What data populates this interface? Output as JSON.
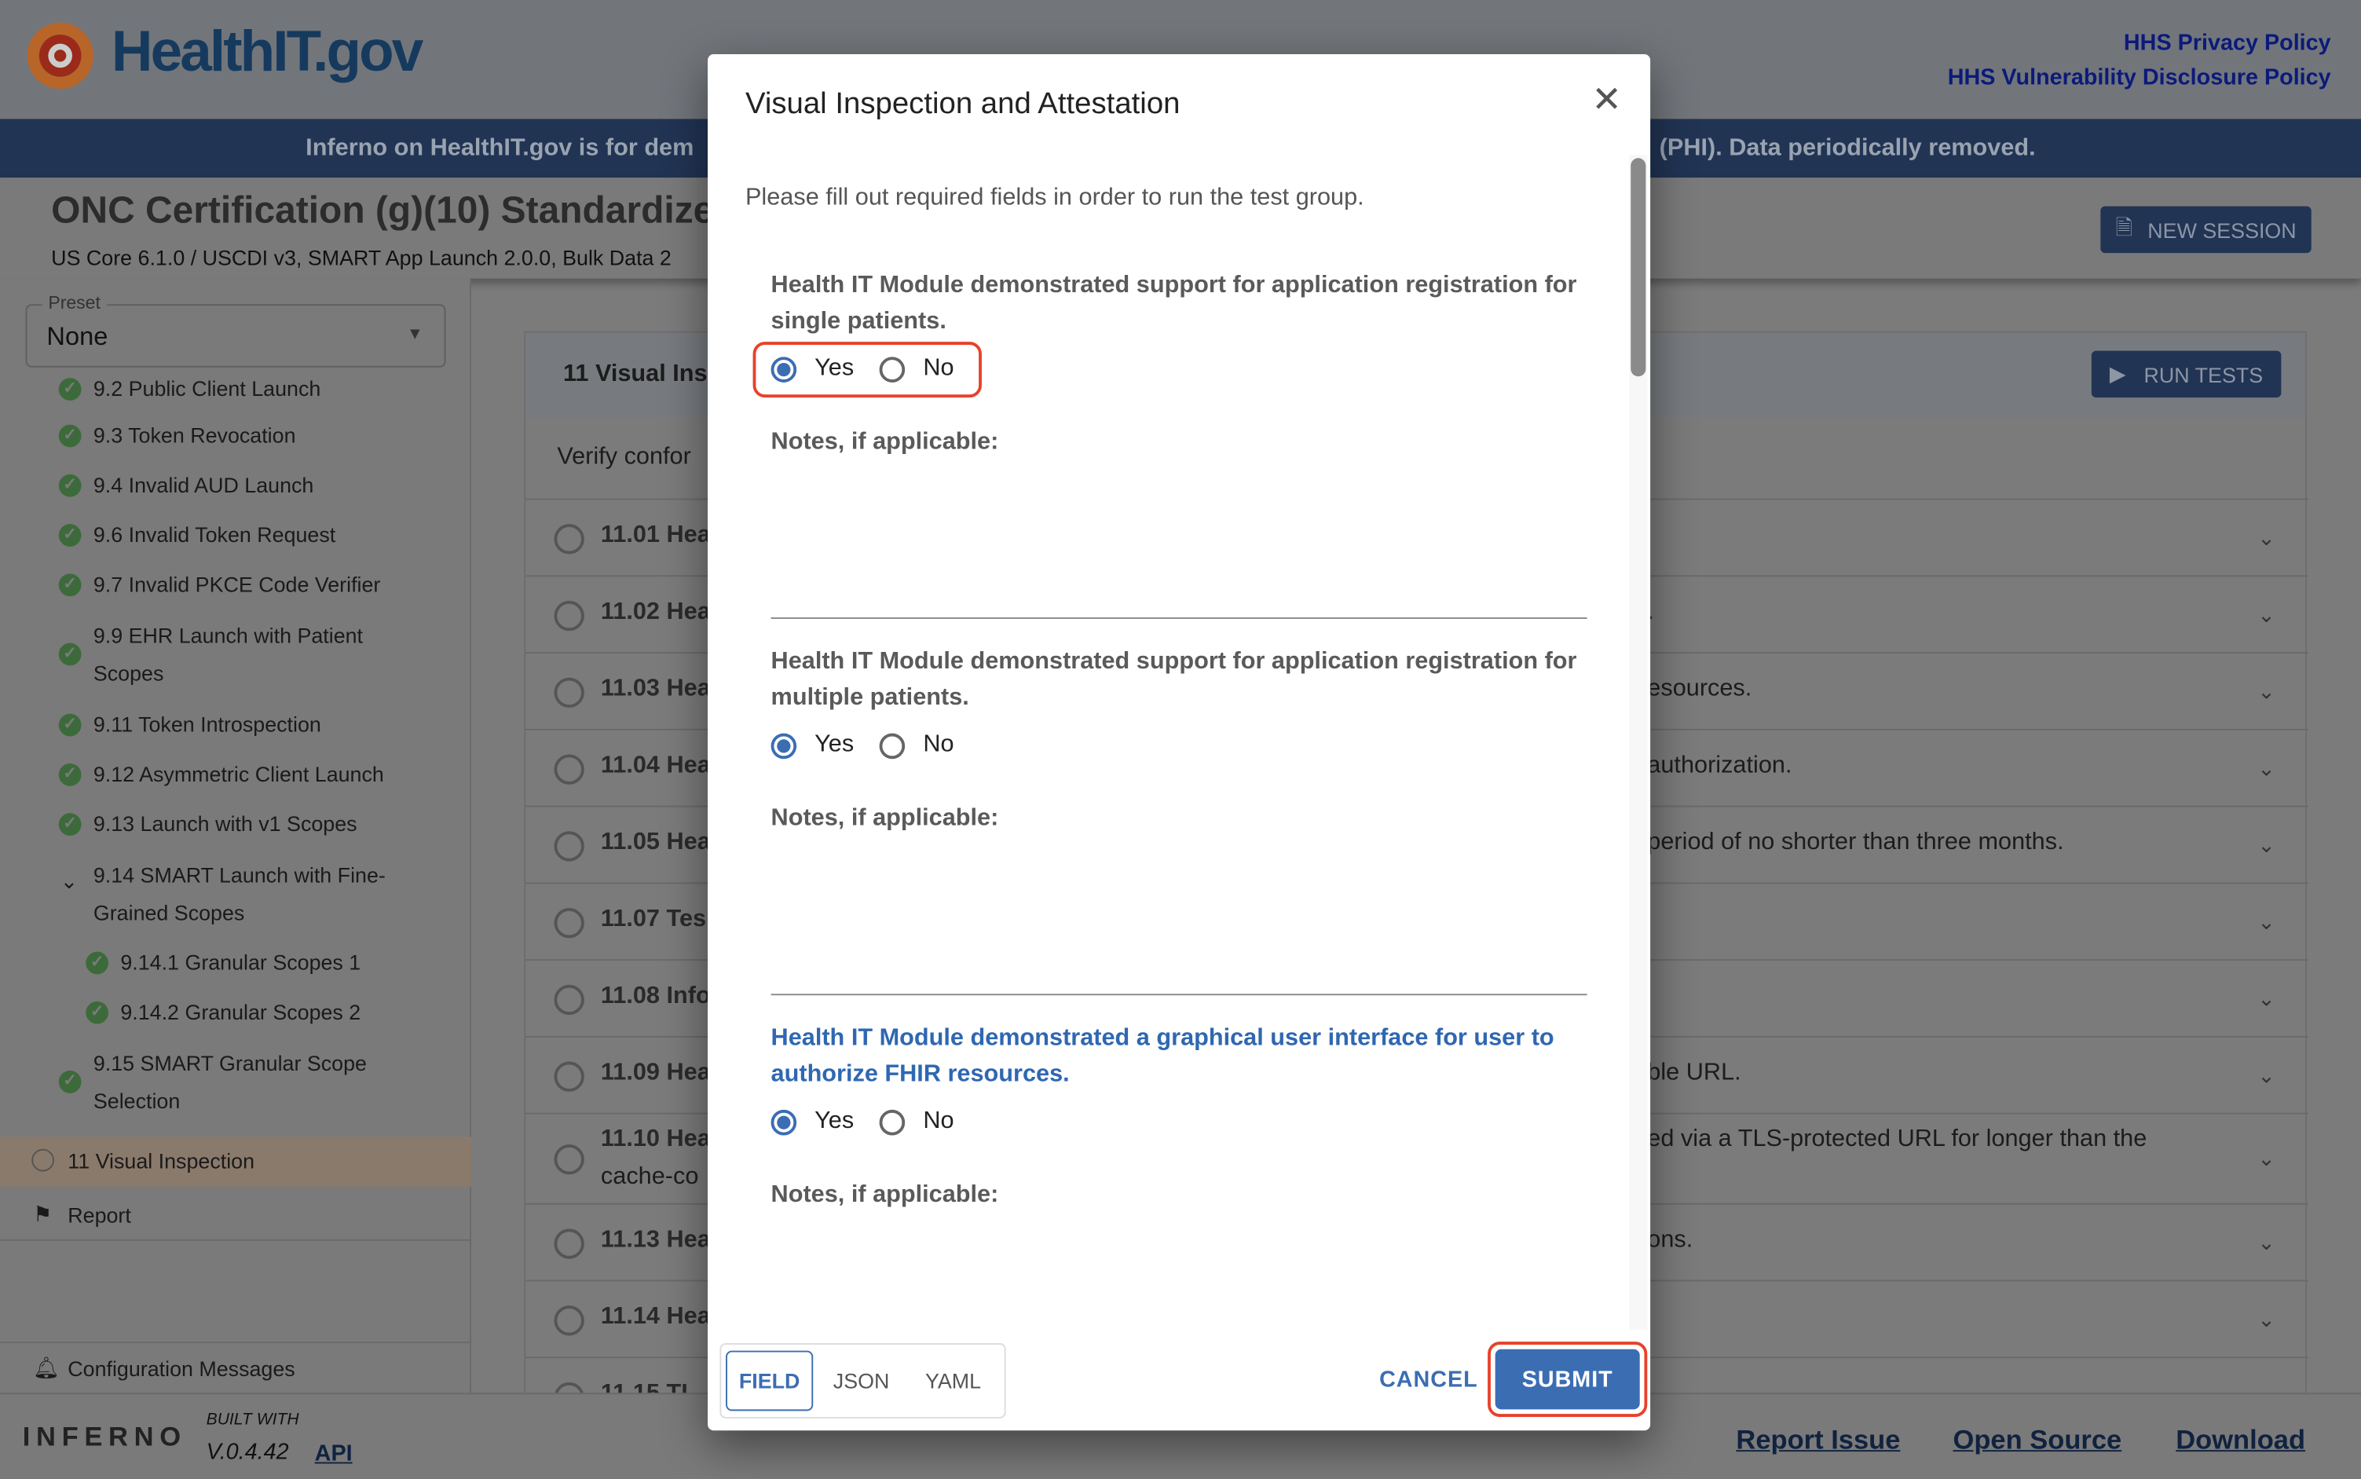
{
  "header": {
    "logo": "HealthIT.gov",
    "links": [
      "HHS Privacy Policy",
      "HHS Vulnerability Disclosure Policy"
    ]
  },
  "banner": {
    "left": "Inferno on HealthIT.gov is for dem",
    "right": "(PHI). Data periodically removed."
  },
  "title": {
    "main": "ONC Certification (g)(10) Standardize",
    "subtitle": "US Core 6.1.0 / USCDI v3, SMART App Launch 2.0.0, Bulk Data 2",
    "new_session": "NEW SESSION"
  },
  "sidebar": {
    "preset_label": "Preset",
    "preset_value": "None",
    "items": [
      {
        "label": "9.2 Public Client Launch",
        "status": "pass"
      },
      {
        "label": "9.3 Token Revocation",
        "status": "pass"
      },
      {
        "label": "9.4 Invalid AUD Launch",
        "status": "pass"
      },
      {
        "label": "9.6 Invalid Token Request",
        "status": "pass"
      },
      {
        "label": "9.7 Invalid PKCE Code Verifier",
        "status": "pass"
      },
      {
        "label": "9.9 EHR Launch with Patient Scopes",
        "status": "pass"
      },
      {
        "label": "9.11 Token Introspection",
        "status": "pass"
      },
      {
        "label": "9.12 Asymmetric Client Launch",
        "status": "pass"
      },
      {
        "label": "9.13 Launch with v1 Scopes",
        "status": "pass"
      },
      {
        "label": "9.14 SMART Launch with Fine-Grained Scopes",
        "status": "expanded"
      },
      {
        "label": "9.14.1 Granular Scopes 1",
        "status": "pass"
      },
      {
        "label": "9.14.2 Granular Scopes 2",
        "status": "pass"
      },
      {
        "label": "9.15 SMART Granular Scope Selection",
        "status": "pass"
      },
      {
        "label": "11 Visual Inspection",
        "status": "pending"
      }
    ],
    "report": "Report",
    "config": "Configuration Messages"
  },
  "main": {
    "group_title": "11 Visual Ins",
    "run_tests": "RUN TESTS",
    "description": "Verify confor",
    "rows": [
      {
        "left": "11.01 Hea",
        "right": ""
      },
      {
        "left": "11.02 Hea",
        "right": "."
      },
      {
        "left": "11.03 Hea",
        "right": "esources."
      },
      {
        "left": "11.04 Hea",
        "right": "authorization."
      },
      {
        "left": "11.05 Hea",
        "right": "period of no shorter than three months."
      },
      {
        "left": "11.07 Tes",
        "right": ""
      },
      {
        "left": "11.08 Info",
        "right": ""
      },
      {
        "left": "11.09 Hea",
        "right": "ble URL."
      },
      {
        "left": "11.10 Hea",
        "left2": "cache-co",
        "right": "ed via a TLS-protected URL for longer than the"
      },
      {
        "left": "11.13 Hea",
        "right": "ons."
      },
      {
        "left": "11.14 Hea",
        "right": ""
      },
      {
        "left": "11.15 TL",
        "right": ""
      }
    ]
  },
  "footer": {
    "built_with": "BUILT WITH",
    "version": "V.0.4.42",
    "api": "API",
    "links": [
      "Report Issue",
      "Open Source",
      "Download"
    ],
    "logo": "INFERNO"
  },
  "modal": {
    "title": "Visual Inspection and Attestation",
    "instructions": "Please fill out required fields in order to run the test group.",
    "questions": [
      {
        "label": "Health IT Module demonstrated support for application registration for single patients.",
        "selected": "Yes"
      },
      {
        "label": "Health IT Module demonstrated support for application registration for multiple patients.",
        "selected": "Yes"
      },
      {
        "label": "Health IT Module demonstrated a graphical user interface for user to authorize FHIR resources.",
        "selected": "Yes"
      }
    ],
    "yes": "Yes",
    "no": "No",
    "notes_label": "Notes, if applicable:",
    "tabs": [
      "FIELD",
      "JSON",
      "YAML"
    ],
    "active_tab": "FIELD",
    "cancel": "CANCEL",
    "submit": "SUBMIT"
  },
  "colors": {
    "accent": "#3b6db3",
    "highlight": "#e8412a",
    "banner": "#213454"
  }
}
